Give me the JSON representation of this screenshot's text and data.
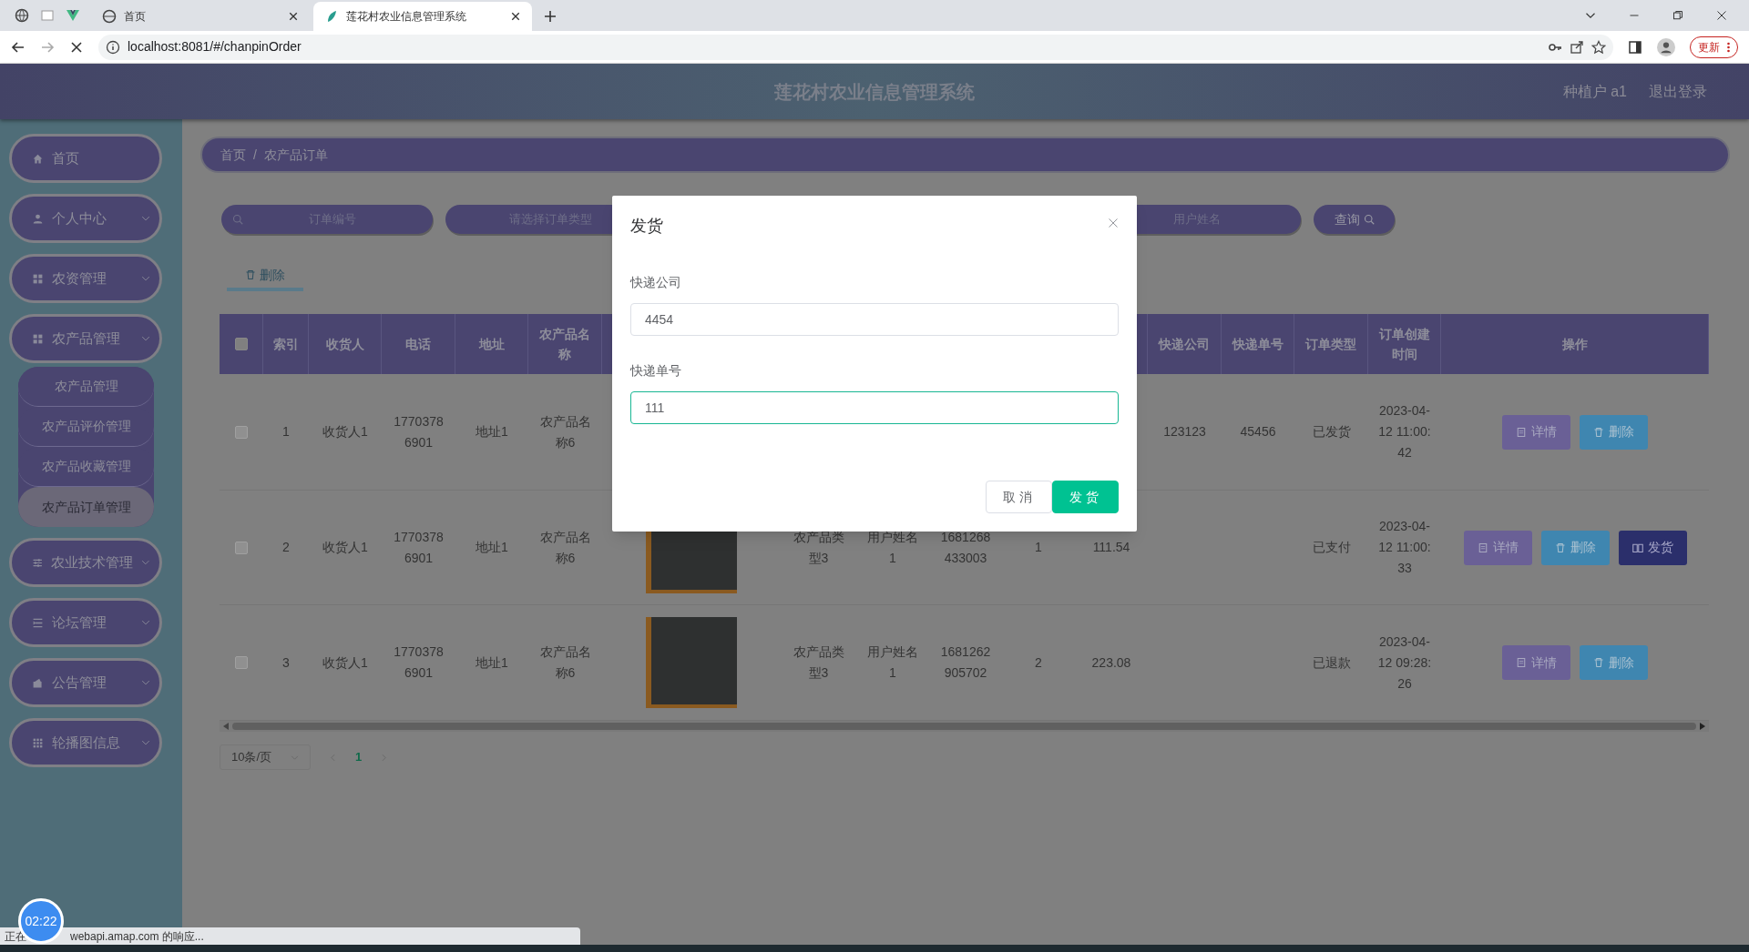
{
  "browser": {
    "tabs": [
      {
        "label": "首页",
        "selected": false
      },
      {
        "label": "莲花村农业信息管理系统",
        "selected": true
      }
    ],
    "address": "localhost:8081/#/chanpinOrder",
    "update_button": "更新"
  },
  "header": {
    "title": "莲花村农业信息管理系统",
    "user": "种植户 a1",
    "logout": "退出登录"
  },
  "sidebar": {
    "items": [
      {
        "label": "首页",
        "kind": "home",
        "submenu": false
      },
      {
        "label": "个人中心",
        "kind": "user",
        "submenu": true
      },
      {
        "label": "农资管理",
        "kind": "grid",
        "submenu": true
      },
      {
        "label": "农产品管理",
        "kind": "grid",
        "submenu": true,
        "children": [
          {
            "label": "农产品管理",
            "selected": false
          },
          {
            "label": "农产品评价管理",
            "selected": false
          },
          {
            "label": "农产品收藏管理",
            "selected": false
          },
          {
            "label": "农产品订单管理",
            "selected": true
          }
        ]
      },
      {
        "label": "农业技术管理",
        "kind": "sliders",
        "submenu": true
      },
      {
        "label": "论坛管理",
        "kind": "list",
        "submenu": true
      },
      {
        "label": "公告管理",
        "kind": "wallet",
        "submenu": true
      },
      {
        "label": "轮播图信息",
        "kind": "apps",
        "submenu": true
      }
    ]
  },
  "breadcrumb": {
    "items": [
      "首页",
      "农产品订单"
    ],
    "separator": "/"
  },
  "search": {
    "fields": [
      {
        "placeholder": "订单编号",
        "icon": true
      },
      {
        "placeholder": "请选择订单类型",
        "icon": false
      },
      {
        "placeholder": "用户姓名",
        "icon": false
      }
    ],
    "button": "查询"
  },
  "toolbar": {
    "delete": "删除"
  },
  "table": {
    "select_all": {
      "checked": false
    },
    "columns": [
      {
        "label": "索引"
      },
      {
        "label": "收货人"
      },
      {
        "label": "电话"
      },
      {
        "label": "地址"
      },
      {
        "label": "农产品名称"
      },
      {
        "kind": "image"
      },
      {},
      {},
      {},
      {},
      {},
      {
        "label": "快递公司"
      },
      {
        "label": "快递单号"
      },
      {
        "label": "订单类型"
      },
      {
        "label": "订单创建时间"
      },
      {
        "label": "操作"
      }
    ],
    "rows": [
      {
        "checked": false,
        "cells": [
          "1",
          "收货人1",
          "17703786901",
          "地址1",
          "农产品名称6",
          null,
          null,
          null,
          null,
          null,
          null,
          "123123",
          "45456",
          "已发货",
          "2023-04-12 11:00:42"
        ],
        "actions": [
          {
            "kind": "detail",
            "label": "详情"
          },
          {
            "kind": "delete",
            "label": "删除"
          }
        ]
      },
      {
        "checked": false,
        "cells": [
          "2",
          "收货人1",
          "17703786901",
          "地址1",
          "农产品名称6",
          null,
          "农产品类型3",
          "用户姓名1",
          "1681268433003",
          "1",
          "111.54",
          null,
          null,
          "已支付",
          "2023-04-12 11:00:33"
        ],
        "actions": [
          {
            "kind": "detail",
            "label": "详情"
          },
          {
            "kind": "delete",
            "label": "删除"
          },
          {
            "kind": "ship",
            "label": "发货"
          }
        ]
      },
      {
        "checked": false,
        "cells": [
          "3",
          "收货人1",
          "17703786901",
          "地址1",
          "农产品名称6",
          null,
          "农产品类型3",
          "用户姓名1",
          "1681262905702",
          "2",
          "223.08",
          null,
          null,
          "已退款",
          "2023-04-12 09:28:26"
        ],
        "actions": [
          {
            "kind": "detail",
            "label": "详情"
          },
          {
            "kind": "delete",
            "label": "删除"
          }
        ]
      }
    ]
  },
  "pagination": {
    "page_size": "10条/页",
    "pages": [
      {
        "label": "1",
        "selected": true
      }
    ]
  },
  "modal": {
    "title": "发货",
    "fields": [
      {
        "label": "快递公司",
        "value": "4454",
        "focused": false
      },
      {
        "label": "快递单号",
        "value": "111",
        "focused": true
      }
    ],
    "buttons": [
      {
        "kind": "cancel",
        "label": "取消"
      },
      {
        "kind": "confirm",
        "label": "发货"
      }
    ]
  },
  "status_bar": {
    "texts": [
      "正在",
      "webapi.amap.com 的响应..."
    ],
    "timer": "02:22"
  }
}
